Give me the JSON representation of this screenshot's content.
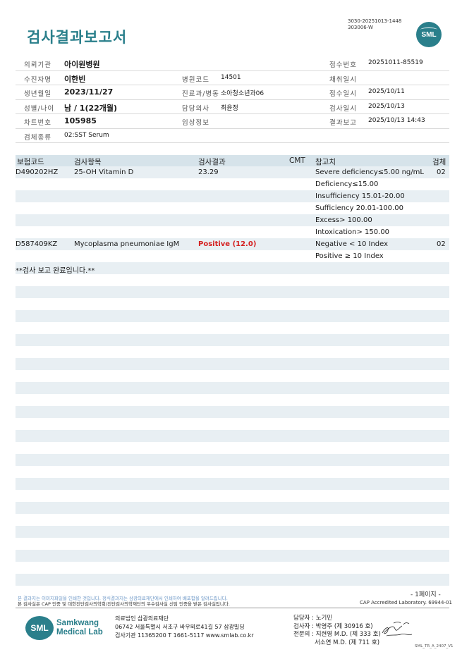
{
  "header": {
    "title": "검사결과보고서",
    "doc_code_1": "3030-20251013-1448",
    "doc_code_2": "303006-W",
    "logo_text": "SML"
  },
  "info": {
    "rows": [
      {
        "l1": "의뢰기관",
        "v1": "아이원병원",
        "l2": "",
        "v2": "",
        "l3": "접수번호",
        "v3": "20251011-85519"
      },
      {
        "l1": "수진자명",
        "v1": "이한빈",
        "l2": "병원코드",
        "v2": "14501",
        "l3": "채취일시",
        "v3": ""
      },
      {
        "l1": "생년월일",
        "v1": "2023/11/27",
        "l2": "진료과/병동",
        "v2": "소아청소년과06",
        "l3": "접수일시",
        "v3": "2025/10/11"
      },
      {
        "l1": "성별/나이",
        "v1": "남 / 1(22개월)",
        "l2": "담당의사",
        "v2": "최윤정",
        "l3": "검사일시",
        "v3": "2025/10/13"
      },
      {
        "l1": "차트번호",
        "v1": "105985",
        "l2": "임상정보",
        "v2": "",
        "l3": "결과보고",
        "v3": "2025/10/13 14:43"
      },
      {
        "l1": "검체종류",
        "v1": "02:SST Serum",
        "l2": "",
        "v2": "",
        "l3": "",
        "v3": ""
      }
    ]
  },
  "results": {
    "headers": {
      "code": "보험코드",
      "item": "검사항목",
      "result": "검사결과",
      "cmt": "CMT",
      "ref": "참고치",
      "specimen": "검체"
    },
    "rows": [
      {
        "code": "D490202HZ",
        "item": "25-OH Vitamin D",
        "result": "23.29",
        "positive": false,
        "ref": "Severe deficiency≤5.00 ng/mL",
        "specimen": "02"
      },
      {
        "code": "",
        "item": "",
        "result": "",
        "positive": false,
        "ref": "Deficiency≤15.00",
        "specimen": ""
      },
      {
        "code": "",
        "item": "",
        "result": "",
        "positive": false,
        "ref": "Insufficiency 15.01-20.00",
        "specimen": ""
      },
      {
        "code": "",
        "item": "",
        "result": "",
        "positive": false,
        "ref": "Sufficiency 20.01-100.00",
        "specimen": ""
      },
      {
        "code": "",
        "item": "",
        "result": "",
        "positive": false,
        "ref": "Excess> 100.00",
        "specimen": ""
      },
      {
        "code": "",
        "item": "",
        "result": "",
        "positive": false,
        "ref": "Intoxication> 150.00",
        "specimen": ""
      },
      {
        "code": "D587409KZ",
        "item": "Mycoplasma pneumoniae IgM",
        "result": "Positive (12.0)",
        "positive": true,
        "ref": "Negative < 10 Index",
        "specimen": "02"
      },
      {
        "code": "",
        "item": "",
        "result": "",
        "positive": false,
        "ref": "Positive ≥ 10 Index",
        "specimen": ""
      },
      {
        "code": "**검사 보고 완료입니다.**",
        "item": "",
        "result": "",
        "positive": false,
        "ref": "",
        "specimen": ""
      }
    ],
    "total_rows": 35
  },
  "footer": {
    "page": "- 1페이지 -",
    "notice": "본 결과지는 이미지파일을 인쇄한 것입니다. 정식결과지는 삼광의료재단에서 인쇄하여 배포함을 알려드립니다.",
    "cert_notice": "본 검사실은 CAP 인증 및 대한진단검사의학회/진단검사의학재단의 우수검사실 신임 인증을 받은 검사실입니다.",
    "cap": "CAP Accredited Laboratory. 69944-01",
    "logo_mark": "SML",
    "logo_line1": "Samkwang",
    "logo_line2": "Medical Lab",
    "org_line1": "의료법인 삼광의료재단",
    "org_line2": "06742 서울특별시 서초구 바우뫼로41길 57 삼광빌딩",
    "org_line3": "검사기관 11365200 T 1661-5117 www.smlab.co.kr",
    "staff_manager": "담당자 :  노기민",
    "staff_tester": "검사자 :  박영주 (제 30916 호)",
    "staff_expert1": "전문의 :  지현영 M.D. (제 333 호)",
    "staff_expert2": "서소연 M.D. (제 711 호)",
    "form_code": "SML_TR_A_2407_V1"
  }
}
